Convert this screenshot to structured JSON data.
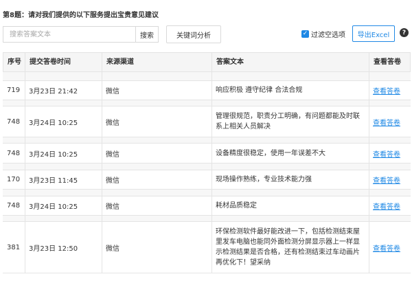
{
  "title": "第8题：请对我们提供的以下服务提出宝贵意见建议",
  "toolbar": {
    "search_placeholder": "搜索答案文本",
    "search_button": "搜索",
    "keyword_button": "关键词分析",
    "filter_checked": true,
    "filter_label": "过滤空选项",
    "export_button": "导出Excel",
    "help": "?"
  },
  "columns": [
    "序号",
    "提交答卷时间",
    "来源渠道",
    "答案文本",
    "查看答卷"
  ],
  "rows": [
    {
      "no": "719",
      "time": "3月23日 21:42",
      "source": "微信",
      "text": "响应积极 遵守纪律 合法合规",
      "action": "查看答卷"
    },
    {
      "no": "748",
      "time": "3月24日 10:25",
      "source": "微信",
      "text": "管理很规范，职责分工明确，有问题都能及时联系上相关人员解决",
      "action": "查看答卷"
    },
    {
      "no": "748",
      "time": "3月24日 10:25",
      "source": "微信",
      "text": "设备精度很稳定，使用一年误差不大",
      "action": "查看答卷"
    },
    {
      "no": "170",
      "time": "3月23日 11:45",
      "source": "微信",
      "text": "现场操作熟练，专业技术能力强",
      "action": "查看答卷"
    },
    {
      "no": "748",
      "time": "3月24日 10:25",
      "source": "微信",
      "text": "耗材品质稳定",
      "action": "查看答卷"
    },
    {
      "no": "381",
      "time": "3月23日 12:50",
      "source": "微信",
      "text": "环保检测软件最好能改进一下，包括检测结束屋里发车电脑也能同外面检测分屏显示器上一样显示检测结果是否合格，还有检测结束过车动画片再优化下！望采纳",
      "action": "查看答卷"
    }
  ]
}
